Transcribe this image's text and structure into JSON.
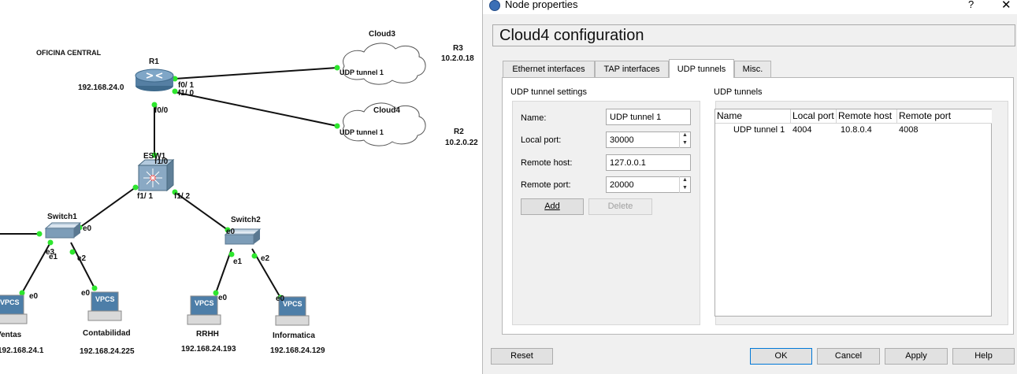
{
  "topology": {
    "office_label": "OFICINA CENTRAL",
    "router": {
      "name": "R1",
      "ip": "192.168.24.0"
    },
    "clouds": [
      {
        "name": "Cloud3",
        "tunnel_label": "UDP tunnel 1",
        "remote_name": "R3",
        "remote_ip": "10.2.0.18"
      },
      {
        "name": "Cloud4",
        "tunnel_label": "UDP tunnel 1",
        "remote_name": "R2",
        "remote_ip": "10.2.0.22"
      }
    ],
    "esw": {
      "name": "ESW1"
    },
    "switches": [
      {
        "name": "Switch1"
      },
      {
        "name": "Switch2"
      }
    ],
    "vpcs_badge": "VPCS",
    "hosts": [
      {
        "name": "Ventas",
        "ip": "192.168.24.1"
      },
      {
        "name": "Contabilidad",
        "ip": "192.168.24.225"
      },
      {
        "name": "RRHH",
        "ip": "192.168.24.193"
      },
      {
        "name": "Informatica",
        "ip": "192.168.24.129"
      }
    ],
    "ports": {
      "r1_f0_1": "f0/ 1",
      "r1_f1_0": "f1/ 0",
      "r1_f0_0": "f0/0",
      "esw_f1_0": "f1/0",
      "esw_f1_1": "f1/ 1",
      "esw_f1_2": "f1/ 2",
      "sw1_e0": "e0",
      "sw1_e1": "e1",
      "sw1_e2": "e2",
      "sw1_e3": "e3",
      "sw2_e0": "e0",
      "sw2_e1": "e1",
      "sw2_e2": "e2",
      "pc1_e0": "e0",
      "pc2_e0": "e0",
      "pc3_e0": "e0",
      "pc4_e0": "e0"
    }
  },
  "dialog": {
    "window_title": "Node properties",
    "help_glyph": "?",
    "close_glyph": "✕",
    "heading": "Cloud4 configuration",
    "tabs": [
      {
        "label": "Ethernet interfaces"
      },
      {
        "label": "TAP interfaces"
      },
      {
        "label": "UDP tunnels"
      },
      {
        "label": "Misc."
      }
    ],
    "settings": {
      "group_title": "UDP tunnel settings",
      "name_label": "Name:",
      "name_value": "UDP tunnel 1",
      "local_port_label": "Local port:",
      "local_port_value": "30000",
      "remote_host_label": "Remote host:",
      "remote_host_value": "127.0.0.1",
      "remote_port_label": "Remote port:",
      "remote_port_value": "20000",
      "add_label": "Add",
      "delete_label": "Delete"
    },
    "tunnels": {
      "group_title": "UDP tunnels",
      "columns": [
        "Name",
        "Local port",
        "Remote host",
        "Remote port"
      ],
      "rows": [
        {
          "name": "UDP tunnel 1",
          "local_port": "4004",
          "remote_host": "10.8.0.4",
          "remote_port": "4008"
        }
      ]
    },
    "buttons": {
      "reset": "Reset",
      "ok": "OK",
      "cancel": "Cancel",
      "apply": "Apply",
      "help": "Help"
    }
  }
}
